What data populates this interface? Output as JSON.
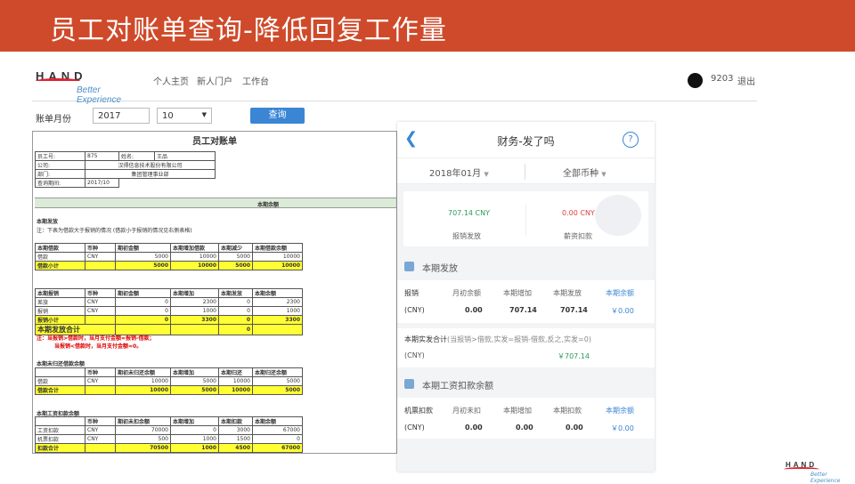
{
  "slide": {
    "title": "员工对账单查询-降低回复工作量",
    "title_bg": "#cf4a2a"
  },
  "portal": {
    "logo_text": "HAND",
    "logo_tagline": "Better Experience",
    "nav": [
      "个人主页",
      "新人门户",
      "工作台"
    ],
    "user_id": "9203",
    "logout": "退出"
  },
  "query": {
    "label": "账单月份",
    "year": "2017",
    "month": "10",
    "button": "查询",
    "accent": "#3a86d4"
  },
  "sheet": {
    "title": "员工对账单",
    "info": [
      [
        "员工号:",
        "875",
        "姓名:",
        "王品"
      ],
      [
        "公司:",
        "汉得信息技术股份有限公司"
      ],
      [
        "部门:",
        "集团管理事业部"
      ],
      [
        "查询期间:",
        "2017/10"
      ]
    ],
    "band": "本期余额",
    "sec1_title": "本期发放",
    "sec1_note": "注：下表为借款大于报销的情况 (借款小于报销的情况见右侧表格)",
    "t1_head": [
      "本期借款",
      "币种",
      "期初金额",
      "本期增加借款",
      "本期减少",
      "本期借款余额"
    ],
    "t1_rows": [
      [
        "借款",
        "CNY",
        "5000",
        "10000",
        "5000",
        "10000"
      ]
    ],
    "t1_total": [
      "借款小计",
      "",
      "5000",
      "10000",
      "5000",
      "10000"
    ],
    "t2_head": [
      "本期报销",
      "币种",
      "期初金额",
      "本期增加",
      "本期发放",
      "本期余额"
    ],
    "t2_rows": [
      [
        "差旅",
        "CNY",
        "0",
        "2300",
        "0",
        "2300"
      ],
      [
        "报销",
        "CNY",
        "0",
        "1000",
        "0",
        "1000"
      ]
    ],
    "t2_total": [
      "报销小计",
      "",
      "0",
      "3300",
      "0",
      "3300"
    ],
    "t2_grand": [
      "本期发放合计",
      "",
      "",
      "",
      "0",
      ""
    ],
    "red_note1": "注：当报销>借款时，当月支付金额=报销-借款；",
    "red_note2": "当报销<借款时，当月支付金额=0。",
    "sec3_title": "本期未归还借款余额",
    "t3_head": [
      "",
      "币种",
      "期初未归还余额",
      "本期增加",
      "本期归还",
      "本期归还余额"
    ],
    "t3_rows": [
      [
        "借款",
        "CNY",
        "10000",
        "5000",
        "10000",
        "5000"
      ]
    ],
    "t3_total": [
      "借款合计",
      "",
      "10000",
      "5000",
      "10000",
      "5000"
    ],
    "sec4_title": "本期工资扣款余额",
    "t4_head": [
      "",
      "币种",
      "期初未扣余额",
      "本期增加",
      "本期扣款",
      "本期余额"
    ],
    "t4_rows": [
      [
        "工资扣款",
        "CNY",
        "70000",
        "0",
        "3000",
        "67000"
      ],
      [
        "机票扣款",
        "CNY",
        "500",
        "1000",
        "1500",
        "0"
      ]
    ],
    "t4_total": [
      "扣款合计",
      "",
      "70500",
      "1000",
      "4500",
      "67000"
    ]
  },
  "mobile": {
    "title": "财务-发了吗",
    "filter_month": "2018年01月",
    "filter_currency": "全部币种",
    "card_left_value": "707.14 CNY",
    "card_left_label": "报销发放",
    "card_right_value": "0.00 CNY",
    "card_right_label": "薪资扣款",
    "sec1": "本期发放",
    "sec1_cols": [
      "报销",
      "月初余额",
      "本期增加",
      "本期发放",
      "本期余额"
    ],
    "sec1_vals": [
      "(CNY)",
      "0.00",
      "707.14",
      "707.14",
      "￥0.00"
    ],
    "sum_title": "本期实发合计",
    "sum_note": "(当报销>借款,实发=报销-借款,反之,实发=0)",
    "sum_cur": "(CNY)",
    "sum_val": "￥707.14",
    "sec2": "本期工资扣款余额",
    "sec2_cols": [
      "机票扣款",
      "月初未扣",
      "本期增加",
      "本期扣款",
      "本期余额"
    ],
    "sec2_vals": [
      "(CNY)",
      "0.00",
      "0.00",
      "0.00",
      "￥0.00"
    ]
  },
  "footer": {
    "logo_text": "HAND",
    "logo_tagline": "Better Experience"
  }
}
